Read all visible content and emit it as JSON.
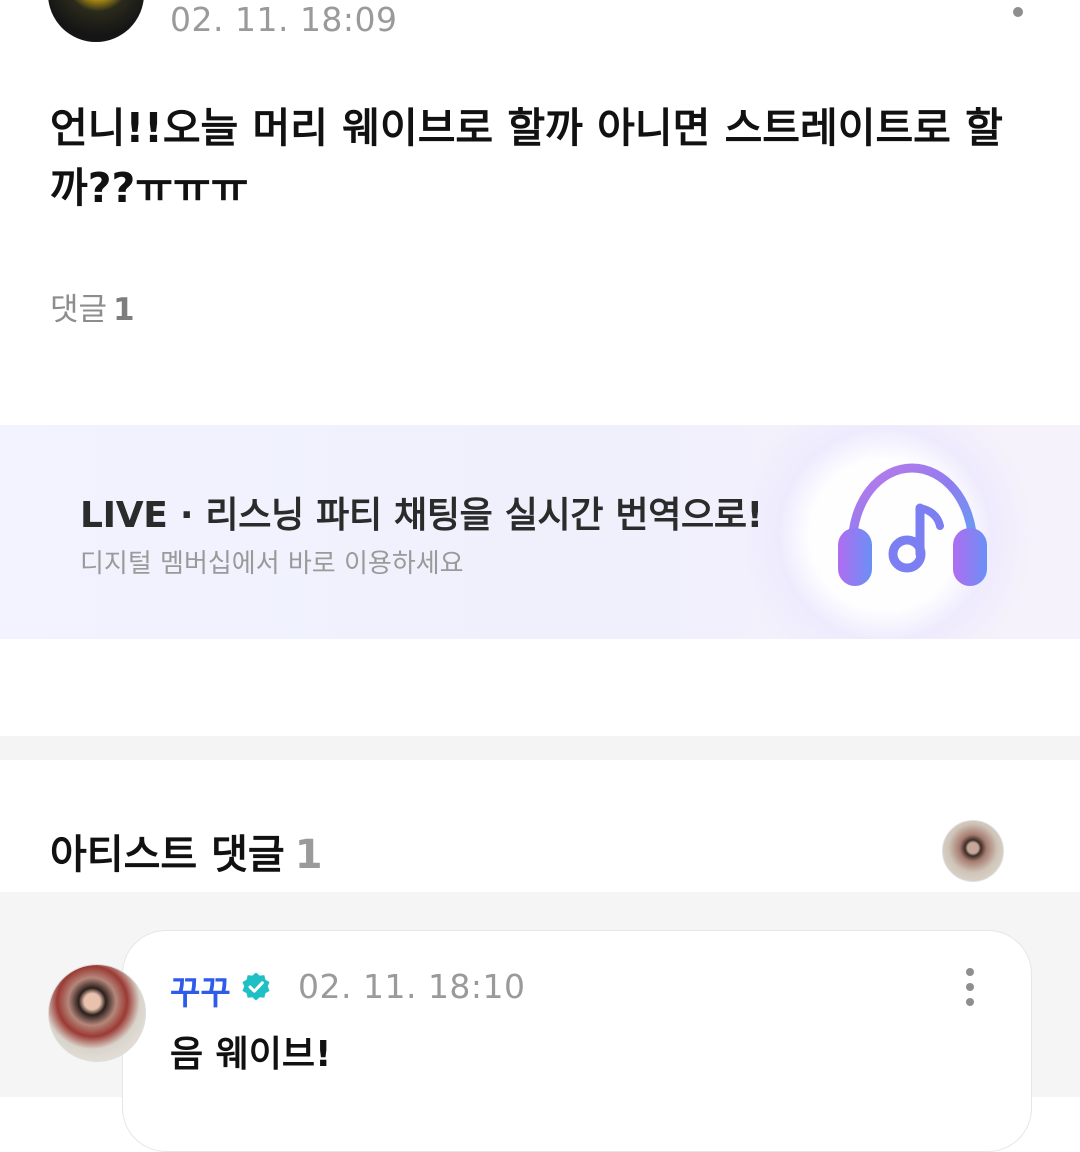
{
  "post": {
    "time": "02. 11. 18:09",
    "body": "언니!!오늘 머리 웨이브로 할까 아니면 스트레이트로 할까??ㅠㅠㅠ",
    "comment_label": "댓글",
    "comment_count": "1"
  },
  "banner": {
    "title": "LIVE · 리스닝 파티 채팅을 실시간 번역으로!",
    "subtitle": "디지털 멤버십에서 바로 이용하세요",
    "icon": "headphones-music-icon",
    "accent": "#8f7cf0"
  },
  "artist_comments": {
    "heading": "아티스트 댓글",
    "count": "1",
    "comments": [
      {
        "author": "꾸꾸",
        "verified": true,
        "time": "02. 11. 18:10",
        "text": "음 웨이브!"
      }
    ]
  },
  "colors": {
    "author_name": "#2f5bea",
    "verified_badge": "#1fbfc6",
    "muted_text": "#9a9a9a"
  }
}
